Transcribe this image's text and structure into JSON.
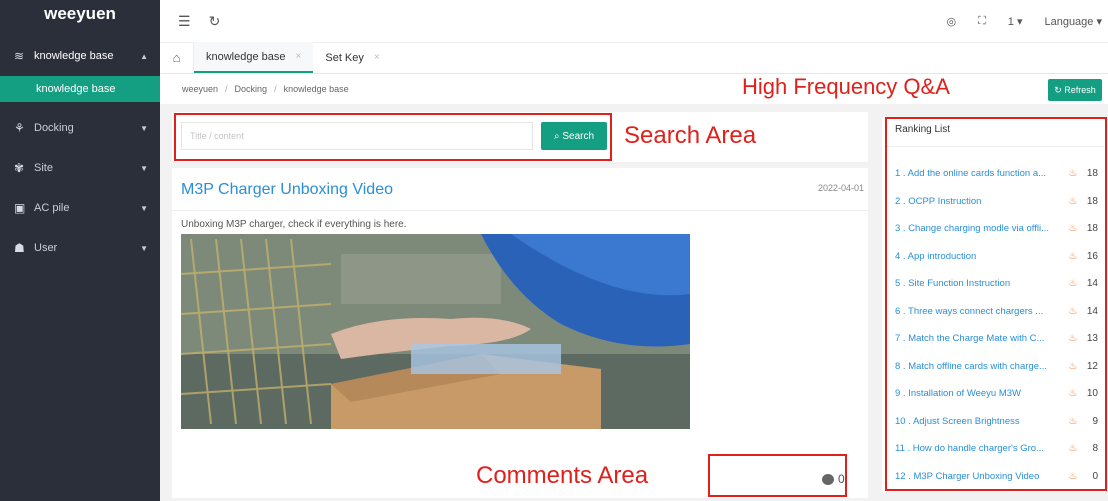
{
  "sidebar": {
    "logo": "weeyuen",
    "menu": [
      {
        "icon": "layers-icon",
        "glyph": "≋",
        "label": "knowledge base",
        "arrow": "▲"
      },
      {
        "icon": "docking-icon",
        "glyph": "⚘",
        "label": "Docking",
        "arrow": "▼"
      },
      {
        "icon": "site-icon",
        "glyph": "✾",
        "label": "Site",
        "arrow": "▼"
      },
      {
        "icon": "ac-pile-icon",
        "glyph": "▣",
        "label": "AC pile",
        "arrow": "▼"
      },
      {
        "icon": "user-icon",
        "glyph": "☗",
        "label": "User",
        "arrow": "▼"
      }
    ],
    "active_sub": "knowledge base"
  },
  "topbar": {
    "collapse_glyph": "☰",
    "refresh_glyph": "↻",
    "theme_glyph": "◎",
    "fullscreen_glyph": "⛶",
    "user_label": "1 ▾",
    "language_label": "Language ▾"
  },
  "tabs": {
    "home_glyph": "⌂",
    "items": [
      {
        "label": "knowledge base",
        "close": "×"
      },
      {
        "label": "Set Key",
        "close": "×"
      }
    ]
  },
  "breadcrumb": [
    "weeyuen",
    "Docking",
    "knowledge base"
  ],
  "annotations": {
    "high_frequency": "High Frequency Q&A",
    "search_area": "Search Area",
    "comments_area": "Comments Area"
  },
  "refresh_button": "↻ Refresh",
  "search": {
    "placeholder": "Title / content",
    "button": "⌕ Search"
  },
  "article": {
    "title": "M3P Charger Unboxing Video",
    "date": "2022-04-01",
    "description": "Unboxing M3P charger, check if everything is here.",
    "comments": "0"
  },
  "ranking": {
    "title": "Ranking List",
    "items": [
      {
        "text": "1 . Add the online cards function a...",
        "count": "18"
      },
      {
        "text": "2 . OCPP Instruction",
        "count": "18"
      },
      {
        "text": "3 . Change charging modle via offli...",
        "count": "18"
      },
      {
        "text": "4 . App introduction",
        "count": "16"
      },
      {
        "text": "5 . Site Function Instruction",
        "count": "14"
      },
      {
        "text": "6 . Three ways connect chargers ...",
        "count": "14"
      },
      {
        "text": "7 . Match the Charge Mate with C...",
        "count": "13"
      },
      {
        "text": "8 . Match offline cards with charge...",
        "count": "12"
      },
      {
        "text": "9 . Installation of Weeyu M3W",
        "count": "10"
      },
      {
        "text": "10 . Adjust Screen Brightness",
        "count": "9"
      },
      {
        "text": "11 . How do handle charger's Gro...",
        "count": "8"
      },
      {
        "text": "12 . M3P Charger Unboxing Video",
        "count": "0"
      }
    ]
  },
  "colors": {
    "sidebar_bg": "#2b2f3a",
    "accent": "#149e82",
    "link": "#2a8fd6",
    "annotation_red": "#e0201b"
  }
}
